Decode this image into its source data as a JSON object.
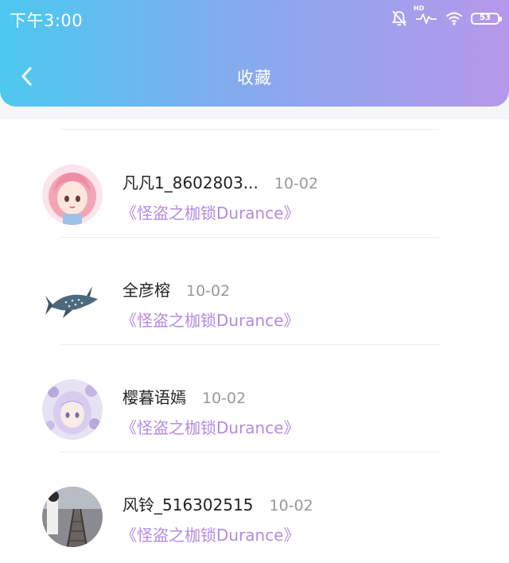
{
  "status_bar": {
    "time": "下午3:00",
    "hd_label": "HD",
    "battery": "53",
    "icons": [
      "bell-off-icon",
      "signal-activity-icon",
      "wifi-icon",
      "battery-icon"
    ]
  },
  "header": {
    "title": "收藏",
    "back_icon": "chevron-left-icon"
  },
  "colors": {
    "gradient_start": "#4cc9ef",
    "gradient_end": "#b698ea",
    "work_title": "#b48ae2",
    "date": "#999999"
  },
  "items": [
    {
      "username": "凡凡1_8602803...",
      "date": "10-02",
      "work": "《怪盗之枷锁Durance》",
      "avatar": "anime-girl-pink-hair-avatar"
    },
    {
      "username": "全彦榕",
      "date": "10-02",
      "work": "《怪盗之枷锁Durance》",
      "avatar": "whale-shark-avatar"
    },
    {
      "username": "樱暮语嫣",
      "date": "10-02",
      "work": "《怪盗之枷锁Durance》",
      "avatar": "anime-girl-purple-flowers-avatar"
    },
    {
      "username": "风铃_516302515",
      "date": "10-02",
      "work": "《怪盗之枷锁Durance》",
      "avatar": "railway-photo-avatar"
    }
  ]
}
